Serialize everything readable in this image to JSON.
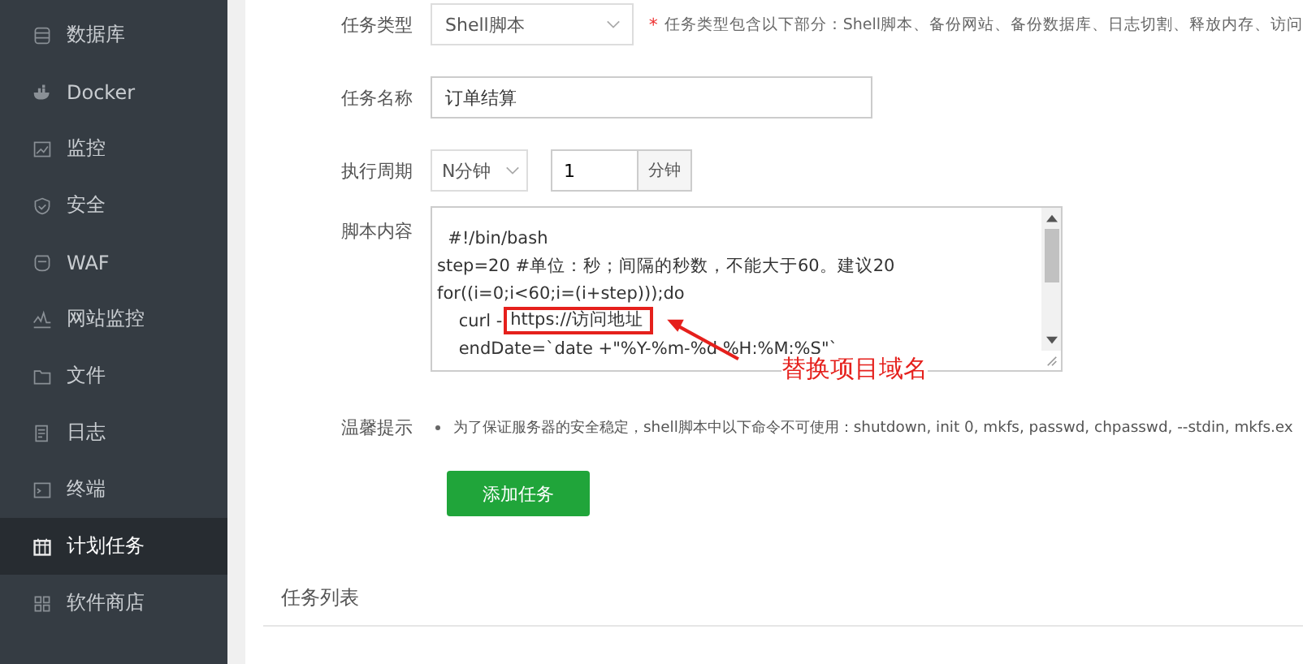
{
  "sidebar": {
    "items": [
      {
        "label": "数据库",
        "kind": "database",
        "selected": false
      },
      {
        "label": "Docker",
        "kind": "docker",
        "selected": false
      },
      {
        "label": "监控",
        "kind": "monitor",
        "selected": false
      },
      {
        "label": "安全",
        "kind": "security",
        "selected": false
      },
      {
        "label": "WAF",
        "kind": "firewall",
        "selected": false
      },
      {
        "label": "网站监控",
        "kind": "sitemonitor",
        "selected": false
      },
      {
        "label": "文件",
        "kind": "files",
        "selected": false
      },
      {
        "label": "日志",
        "kind": "logs",
        "selected": false
      },
      {
        "label": "终端",
        "kind": "terminal",
        "selected": false
      },
      {
        "label": "计划任务",
        "kind": "schedule",
        "selected": true
      },
      {
        "label": "软件商店",
        "kind": "store",
        "selected": false
      }
    ]
  },
  "form": {
    "task_type": {
      "label": "任务类型",
      "value": "Shell脚本",
      "hint_mark": "*",
      "hint": "任务类型包含以下部分：Shell脚本、备份网站、备份数据库、日志切割、释放内存、访问"
    },
    "task_name": {
      "label": "任务名称",
      "value": "订单结算"
    },
    "period": {
      "label": "执行周期",
      "unit": "N分钟",
      "value": "1",
      "addon": "分钟"
    },
    "script": {
      "label": "脚本内容",
      "lines": [
        {
          "text": "  #!/bin/bash"
        },
        {
          "text": "step=20 #单位：秒；间隔的秒数，不能大于60。建议20"
        },
        {
          "text": "for((i=0;i<60;i=(i+step)));do"
        },
        {
          "text": "    curl -",
          "highlight": "https://访问地址"
        },
        {
          "text": "    endDate=`date +\"%Y-%m-%d %H:%M:%S\"`"
        }
      ]
    },
    "tips": {
      "label": "温馨提示",
      "items": [
        "为了保证服务器的安全稳定，shell脚本中以下命令不可使用：shutdown, init 0, mkfs, passwd, chpasswd, --stdin, mkfs.ex"
      ]
    },
    "submit": "添加任务"
  },
  "annotation": "替换项目域名",
  "task_list": {
    "title": "任务列表"
  }
}
